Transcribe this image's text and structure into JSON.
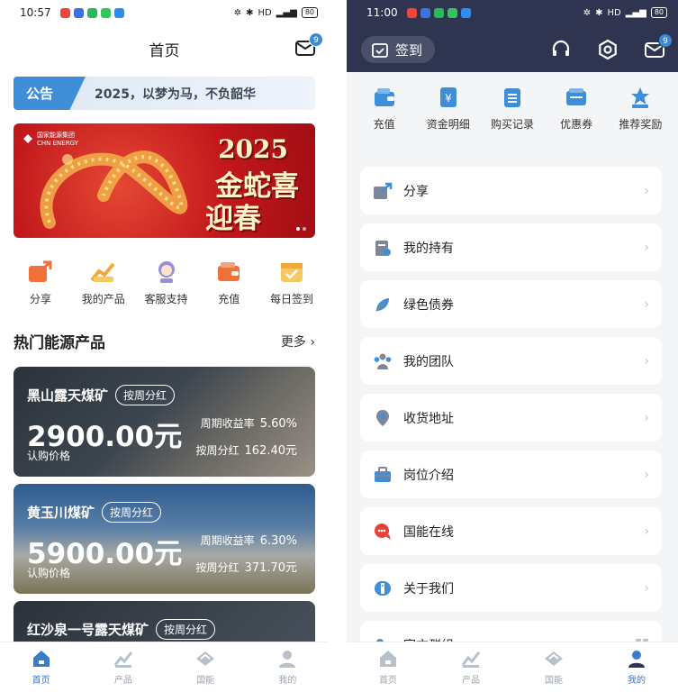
{
  "left": {
    "status": {
      "time": "10:57",
      "battery": "80"
    },
    "header": {
      "title": "首页",
      "badge": "9"
    },
    "notice": {
      "tag": "公告",
      "text": "2025，以梦为马，不负韶华"
    },
    "banner": {
      "logo_cn": "国家能源集团",
      "logo_en": "CHN ENERGY",
      "year": "2025",
      "line1": "金蛇喜",
      "line2": "迎春"
    },
    "quick": [
      {
        "label": "分享",
        "icon": "share-icon"
      },
      {
        "label": "我的产品",
        "icon": "product-chart-icon"
      },
      {
        "label": "客服支持",
        "icon": "support-agent-icon"
      },
      {
        "label": "充值",
        "icon": "wallet-icon"
      },
      {
        "label": "每日签到",
        "icon": "calendar-check-icon"
      }
    ],
    "section": {
      "title": "热门能源产品",
      "more": "更多"
    },
    "products": [
      {
        "name": "黑山露天煤矿",
        "tag": "按周分红",
        "price": "2900.00元",
        "price_label": "认购价格",
        "rate_label": "周期收益率",
        "rate": "5.60%",
        "div_label": "按周分红",
        "div": "162.40元"
      },
      {
        "name": "黄玉川煤矿",
        "tag": "按周分红",
        "price": "5900.00元",
        "price_label": "认购价格",
        "rate_label": "周期收益率",
        "rate": "6.30%",
        "div_label": "按周分红",
        "div": "371.70元"
      },
      {
        "name": "红沙泉一号露天煤矿",
        "tag": "按周分红"
      }
    ],
    "tabs": [
      {
        "label": "首页",
        "icon": "home-icon",
        "active": true
      },
      {
        "label": "产品",
        "icon": "chart-icon",
        "active": false
      },
      {
        "label": "国能",
        "icon": "brand-icon",
        "active": false
      },
      {
        "label": "我的",
        "icon": "user-icon",
        "active": false
      }
    ]
  },
  "right": {
    "status": {
      "time": "11:00",
      "battery": "80"
    },
    "signin": "签到",
    "badge": "9",
    "features": [
      {
        "label": "充值",
        "icon": "wallet-icon"
      },
      {
        "label": "资金明细",
        "icon": "yuan-doc-icon"
      },
      {
        "label": "购买记录",
        "icon": "clipboard-icon"
      },
      {
        "label": "优惠券",
        "icon": "coupon-icon"
      },
      {
        "label": "推荐奖励",
        "icon": "star-award-icon"
      }
    ],
    "menu": [
      {
        "label": "分享",
        "icon": "share-icon"
      },
      {
        "label": "我的持有",
        "icon": "holdings-icon"
      },
      {
        "label": "绿色债券",
        "icon": "green-bond-icon"
      },
      {
        "label": "我的团队",
        "icon": "team-icon"
      },
      {
        "label": "收货地址",
        "icon": "location-pin-icon"
      },
      {
        "label": "岗位介绍",
        "icon": "briefcase-icon"
      },
      {
        "label": "国能在线",
        "icon": "chat-online-icon"
      },
      {
        "label": "关于我们",
        "icon": "about-icon"
      },
      {
        "label": "官方群组",
        "icon": "group-icon"
      }
    ],
    "tabs": [
      {
        "label": "首页",
        "icon": "home-icon",
        "active": false
      },
      {
        "label": "产品",
        "icon": "chart-icon",
        "active": false
      },
      {
        "label": "国能",
        "icon": "brand-icon",
        "active": false
      },
      {
        "label": "我的",
        "icon": "user-icon",
        "active": true
      }
    ]
  },
  "colors": {
    "accent": "#3b7bc8",
    "dark_header": "#2f3450",
    "icon_orange": "#f0703a",
    "banner_red": "#c1161b"
  }
}
